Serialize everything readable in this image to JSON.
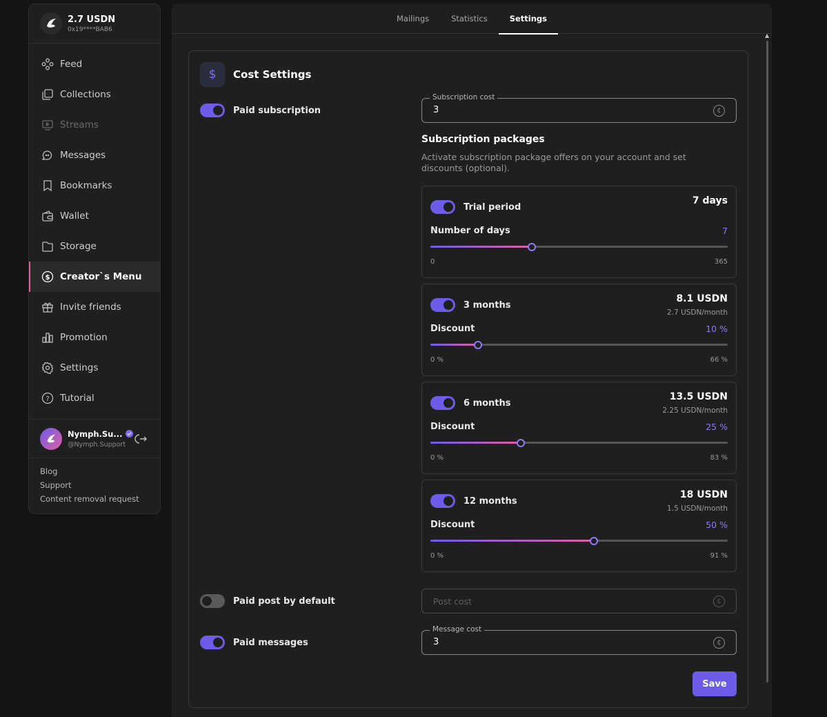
{
  "account": {
    "balance": "2.7 USDN",
    "address": "0x19****BAB6"
  },
  "sidebar": {
    "items": [
      {
        "label": "Feed",
        "icon": "feed-icon"
      },
      {
        "label": "Collections",
        "icon": "collections-icon"
      },
      {
        "label": "Streams",
        "icon": "streams-icon"
      },
      {
        "label": "Messages",
        "icon": "messages-icon"
      },
      {
        "label": "Bookmarks",
        "icon": "bookmark-icon"
      },
      {
        "label": "Wallet",
        "icon": "wallet-icon"
      },
      {
        "label": "Storage",
        "icon": "storage-icon"
      },
      {
        "label": "Creator`s Menu",
        "icon": "dollar-circle-icon"
      },
      {
        "label": "Invite friends",
        "icon": "gift-icon"
      },
      {
        "label": "Promotion",
        "icon": "promotion-icon"
      },
      {
        "label": "Settings",
        "icon": "gear-icon"
      },
      {
        "label": "Tutorial",
        "icon": "help-icon"
      }
    ]
  },
  "user": {
    "name": "Nymph.Su...",
    "handle": "@Nymph.Support"
  },
  "footer": {
    "blog": "Blog",
    "support": "Support",
    "removal": "Content removal request"
  },
  "tabs": [
    "Mailings",
    "Statistics",
    "Settings"
  ],
  "cost_settings": {
    "title": "Cost Settings",
    "paid_subscription": {
      "label": "Paid subscription",
      "enabled": true
    },
    "subscription_cost": {
      "legend": "Subscription cost",
      "value": "3"
    },
    "packages_title": "Subscription packages",
    "packages_desc": "Activate subscription package offers on your account and set discounts (optional).",
    "packages": [
      {
        "label": "Trial period",
        "enabled": true,
        "price": "7 days",
        "sub": "",
        "slider_label": "Number of days",
        "slider_value": "7",
        "min": "0",
        "max": "365",
        "fraction": 0.34
      },
      {
        "label": "3 months",
        "enabled": true,
        "price": "8.1 USDN",
        "sub": "2.7 USDN/month",
        "slider_label": "Discount",
        "slider_value": "10 %",
        "min": "0 %",
        "max": "66 %",
        "fraction": 0.16
      },
      {
        "label": "6 months",
        "enabled": true,
        "price": "13.5 USDN",
        "sub": "2.25 USDN/month",
        "slider_label": "Discount",
        "slider_value": "25 %",
        "min": "0 %",
        "max": "83 %",
        "fraction": 0.305
      },
      {
        "label": "12 months",
        "enabled": true,
        "price": "18 USDN",
        "sub": "1.5 USDN/month",
        "slider_label": "Discount",
        "slider_value": "50 %",
        "min": "0 %",
        "max": "91 %",
        "fraction": 0.549
      }
    ],
    "paid_post": {
      "label": "Paid post by default",
      "enabled": false,
      "placeholder": "Post cost"
    },
    "paid_messages": {
      "label": "Paid messages",
      "enabled": true
    },
    "message_cost": {
      "legend": "Message cost",
      "value": "3"
    },
    "save_label": "Save"
  },
  "colors": {
    "accent": "#6d5ce8",
    "accent_pink": "#e05fa3",
    "slider_value": "#8c7cf5"
  }
}
